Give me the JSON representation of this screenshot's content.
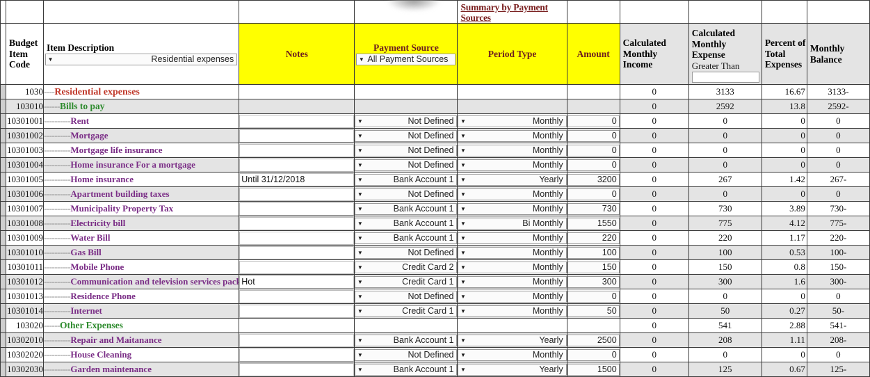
{
  "header": {
    "summary_link": "Summary by Payment Sources",
    "columns": {
      "budget_item_code": "Budget Item Code",
      "item_description": "Item Description",
      "notes": "Notes",
      "payment_source": "Payment Source",
      "period_type": "Period Type",
      "amount": "Amount",
      "calculated_monthly_income": "Calculated Monthly Income",
      "calculated_monthly_expense": "Calculated Monthly Expense",
      "greater_than_label": "Greater Than",
      "greater_than_value": "",
      "percent_of_total_expenses": "Percent of Total Expenses",
      "monthly_balance": "Monthly Balance"
    },
    "filters": {
      "item_description_filter": "Residential expenses",
      "payment_source_filter": "All Payment Sources",
      "dropdown_arrow": "▼"
    }
  },
  "rows": [
    {
      "code": "1030",
      "dashes": "----",
      "desc": "Residential expenses",
      "level": 1,
      "note": "",
      "payment_source": "",
      "period_type": "",
      "amount": "",
      "income": "0",
      "expense": "3133",
      "percent": "16.67",
      "balance": "3133-"
    },
    {
      "code": "103010",
      "dashes": "------",
      "desc": "Bills to pay",
      "level": 2,
      "note": "",
      "payment_source": "",
      "period_type": "",
      "amount": "",
      "income": "0",
      "expense": "2592",
      "percent": "13.8",
      "balance": "2592-"
    },
    {
      "code": "10301001",
      "dashes": "----------",
      "desc": "Rent",
      "level": 3,
      "note": "",
      "payment_source": "Not Defined",
      "period_type": "Monthly",
      "amount": "0",
      "income": "0",
      "expense": "0",
      "percent": "0",
      "balance": "0"
    },
    {
      "code": "10301002",
      "dashes": "----------",
      "desc": "Mortgage",
      "level": 3,
      "note": "",
      "payment_source": "Not Defined",
      "period_type": "Monthly",
      "amount": "0",
      "income": "0",
      "expense": "0",
      "percent": "0",
      "balance": "0"
    },
    {
      "code": "10301003",
      "dashes": "----------",
      "desc": "Mortgage life insurance",
      "level": 3,
      "note": "",
      "payment_source": "Not Defined",
      "period_type": "Monthly",
      "amount": "0",
      "income": "0",
      "expense": "0",
      "percent": "0",
      "balance": "0"
    },
    {
      "code": "10301004",
      "dashes": "----------",
      "desc": "Home insurance For a mortgage",
      "level": 3,
      "note": "",
      "payment_source": "Not Defined",
      "period_type": "Monthly",
      "amount": "0",
      "income": "0",
      "expense": "0",
      "percent": "0",
      "balance": "0"
    },
    {
      "code": "10301005",
      "dashes": "----------",
      "desc": "Home insurance",
      "level": 3,
      "note": "Until 31/12/2018",
      "payment_source": "Bank Account 1",
      "period_type": "Yearly",
      "amount": "3200",
      "income": "0",
      "expense": "267",
      "percent": "1.42",
      "balance": "267-"
    },
    {
      "code": "10301006",
      "dashes": "----------",
      "desc": "Apartment building taxes",
      "level": 3,
      "note": "",
      "payment_source": "Not Defined",
      "period_type": "Monthly",
      "amount": "0",
      "income": "0",
      "expense": "0",
      "percent": "0",
      "balance": "0"
    },
    {
      "code": "10301007",
      "dashes": "----------",
      "desc": "Municipality Property Tax",
      "level": 3,
      "note": "",
      "payment_source": "Bank Account 1",
      "period_type": "Monthly",
      "amount": "730",
      "income": "0",
      "expense": "730",
      "percent": "3.89",
      "balance": "730-"
    },
    {
      "code": "10301008",
      "dashes": "----------",
      "desc": "Electricity bill",
      "level": 3,
      "note": "",
      "payment_source": "Bank Account 1",
      "period_type": "Bi Monthly",
      "amount": "1550",
      "income": "0",
      "expense": "775",
      "percent": "4.12",
      "balance": "775-"
    },
    {
      "code": "10301009",
      "dashes": "----------",
      "desc": "Water Bill",
      "level": 3,
      "note": "",
      "payment_source": "Bank Account 1",
      "period_type": "Monthly",
      "amount": "220",
      "income": "0",
      "expense": "220",
      "percent": "1.17",
      "balance": "220-"
    },
    {
      "code": "10301010",
      "dashes": "----------",
      "desc": "Gas Bill",
      "level": 3,
      "note": "",
      "payment_source": "Not Defined",
      "period_type": "Monthly",
      "amount": "100",
      "income": "0",
      "expense": "100",
      "percent": "0.53",
      "balance": "100-"
    },
    {
      "code": "10301011",
      "dashes": "----------",
      "desc": "Mobile Phone",
      "level": 3,
      "note": "",
      "payment_source": "Credit Card 2",
      "period_type": "Monthly",
      "amount": "150",
      "income": "0",
      "expense": "150",
      "percent": "0.8",
      "balance": "150-"
    },
    {
      "code": "10301012",
      "dashes": "----------",
      "desc": "Communication and television services package",
      "level": 3,
      "note": "Hot",
      "payment_source": "Credit Card 1",
      "period_type": "Monthly",
      "amount": "300",
      "income": "0",
      "expense": "300",
      "percent": "1.6",
      "balance": "300-"
    },
    {
      "code": "10301013",
      "dashes": "----------",
      "desc": "Residence Phone",
      "level": 3,
      "note": "",
      "payment_source": "Not Defined",
      "period_type": "Monthly",
      "amount": "0",
      "income": "0",
      "expense": "0",
      "percent": "0",
      "balance": "0"
    },
    {
      "code": "10301014",
      "dashes": "----------",
      "desc": "Internet",
      "level": 3,
      "note": "",
      "payment_source": "Credit Card 1",
      "period_type": "Monthly",
      "amount": "50",
      "income": "0",
      "expense": "50",
      "percent": "0.27",
      "balance": "50-"
    },
    {
      "code": "103020",
      "dashes": "------",
      "desc": "Other Expenses",
      "level": 2,
      "note": "",
      "payment_source": "",
      "period_type": "",
      "amount": "",
      "income": "0",
      "expense": "541",
      "percent": "2.88",
      "balance": "541-"
    },
    {
      "code": "10302010",
      "dashes": "----------",
      "desc": "Repair and Maitanance",
      "level": 3,
      "note": "",
      "payment_source": "Bank Account 1",
      "period_type": "Yearly",
      "amount": "2500",
      "income": "0",
      "expense": "208",
      "percent": "1.11",
      "balance": "208-"
    },
    {
      "code": "10302020",
      "dashes": "----------",
      "desc": "House Cleaning",
      "level": 3,
      "note": "",
      "payment_source": "Not Defined",
      "period_type": "Monthly",
      "amount": "0",
      "income": "0",
      "expense": "0",
      "percent": "0",
      "balance": "0"
    },
    {
      "code": "10302030",
      "dashes": "----------",
      "desc": "Garden maintenance",
      "level": 3,
      "note": "",
      "payment_source": "Bank Account 1",
      "period_type": "Yearly",
      "amount": "1500",
      "income": "0",
      "expense": "125",
      "percent": "0.67",
      "balance": "125-"
    }
  ],
  "colors": {
    "header_yellow": "#ffff00",
    "header_gray": "#e4e4e4",
    "header_title_maroon": "#6d1f1f",
    "level1_red": "#c0392b",
    "level2_green": "#2e8b2e",
    "level3_purple": "#7a2d86",
    "link_maroon": "#7a2020",
    "alt_row_gray": "#e4e4e4"
  }
}
